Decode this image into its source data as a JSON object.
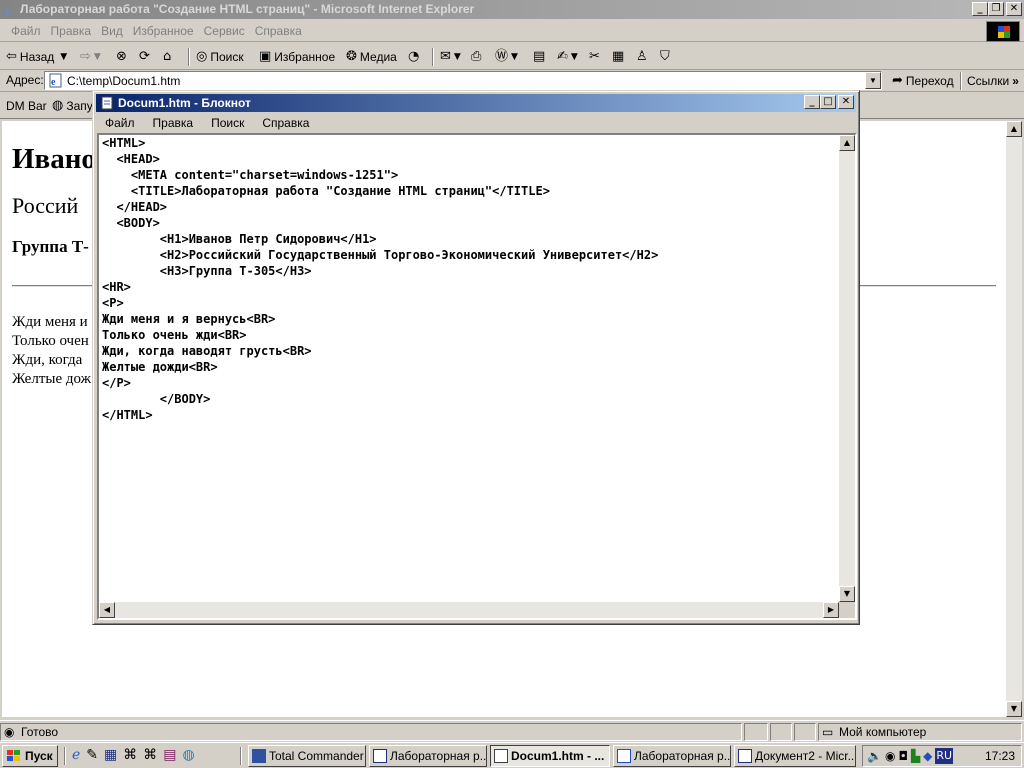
{
  "ie": {
    "title": "Лабораторная работа \"Создание HTML страниц\" - Microsoft Internet Explorer",
    "menu": [
      "Файл",
      "Правка",
      "Вид",
      "Избранное",
      "Сервис",
      "Справка"
    ],
    "toolbar": {
      "back": "Назад",
      "search": "Поиск",
      "favorites": "Избранное",
      "media": "Медиа"
    },
    "address": {
      "label": "Адрес:",
      "value": "C:\\temp\\Docum1.htm",
      "go": "Переход",
      "links": "Ссылки"
    },
    "links_bar": {
      "dm_bar": "DM Bar",
      "launch": "Запу"
    },
    "content": {
      "h1": "Ивано",
      "h2": "Россий",
      "h3": "Группа Т-",
      "lines": [
        "Жди меня и",
        "Только очен",
        "Жди, когда",
        "Желтые дож"
      ]
    },
    "status": {
      "text": "Готово",
      "zone": "Мой компьютер"
    }
  },
  "notepad": {
    "title": "Docum1.htm - Блокнот",
    "menu": [
      "Файл",
      "Правка",
      "Поиск",
      "Справка"
    ],
    "text": "<HTML>\n  <HEAD>\n    <META content=\"charset=windows-1251\">\n    <TITLE>Лабораторная работа \"Создание HTML страниц\"</TITLE>\n  </HEAD>\n  <BODY>\n        <H1>Иванов Петр Сидорович</H1>\n        <H2>Российский Государственный Торгово-Экономический Университет</H2>\n        <H3>Группа Т-305</H3>\n<HR>\n<P>\nЖди меня и я вернусь<BR>\nТолько очень жди<BR>\nЖди, когда наводят грусть<BR>\nЖелтые дожди<BR>\n</P>\n        </BODY>\n</HTML>"
  },
  "taskbar": {
    "start": "Пуск",
    "tasks": [
      "Total Commander ...",
      "Лабораторная р...",
      "Docum1.htm - ...",
      "Лабораторная р...",
      "Документ2 - Micr..."
    ],
    "lang": "RU",
    "clock": "17:23"
  }
}
